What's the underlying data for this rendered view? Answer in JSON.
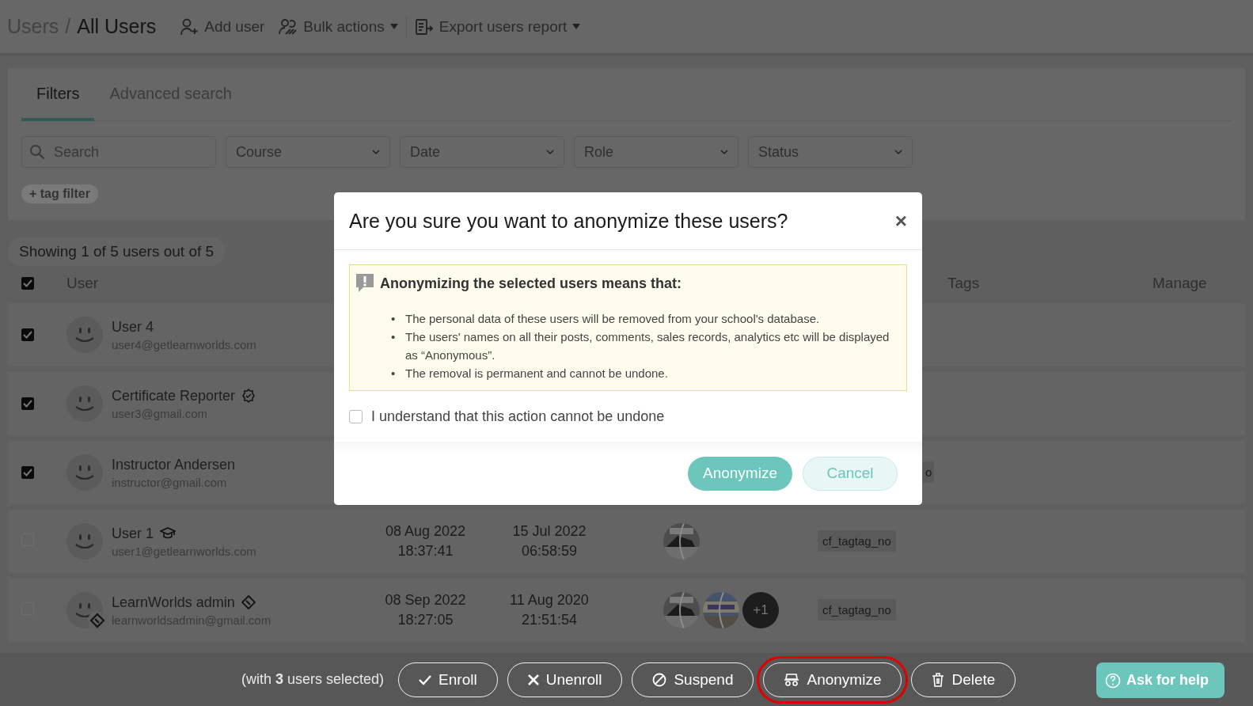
{
  "breadcrumb": [
    {
      "label": "Users",
      "current": false
    },
    {
      "label": "All Users",
      "current": true
    }
  ],
  "breadcrumb_separator": "/",
  "toolbar": [
    {
      "label": "Add user",
      "kind": "add",
      "dropdown": false
    },
    {
      "label": "Bulk actions",
      "kind": "bulk",
      "dropdown": true
    },
    {
      "label": "Export users report",
      "kind": "export",
      "dropdown": true
    }
  ],
  "tabs": [
    {
      "label": "Filters",
      "selected": true
    },
    {
      "label": "Advanced search",
      "selected": false
    }
  ],
  "filters": {
    "search": {
      "placeholder": "Search"
    },
    "dropdowns": [
      "Course",
      "Date",
      "Role",
      "Status"
    ],
    "tag_filter": "+ tag filter"
  },
  "summary": "Showing 1 of 5 users out of 5",
  "table": {
    "select_all": {
      "checked": true
    },
    "columns": [
      {
        "label": "User",
        "kind": "user"
      },
      {
        "label": "Tags",
        "kind": "tags"
      },
      {
        "label": "Manage",
        "kind": "manage"
      }
    ],
    "rows": [
      {
        "name": "User 4",
        "email": "user4@getlearnworlds.com",
        "checked": true,
        "avatar_badge": false
      },
      {
        "name": "Certificate Reporter",
        "email": "user3@gmail.com",
        "checked": true,
        "badges": [
          {
            "kind": "certificate"
          }
        ],
        "avatar_badge": false
      },
      {
        "name": "Instructor Andersen",
        "email": "instructor@gmail.com",
        "checked": true,
        "avatar_badge": false,
        "tags": [
          {
            "label": "o",
            "cut": true
          }
        ]
      },
      {
        "name": "User 1",
        "email": "user1@getlearnworlds.com",
        "checked": false,
        "badges": [
          {
            "kind": "graduation"
          }
        ],
        "avatar_badge": false,
        "date_1": [
          "08 Aug 2022",
          "18:37:41"
        ],
        "date_2": [
          "15 Jul 2022",
          "06:58:59"
        ],
        "courses": [
          {
            "kind": "picture"
          }
        ],
        "tags": [
          {
            "label": "cf_tagtag_no",
            "cut": false
          }
        ]
      },
      {
        "name": "LearnWorlds admin",
        "email": "learnworldsadmin@gmail.com",
        "checked": false,
        "badges": [
          {
            "kind": "diamond"
          }
        ],
        "avatar_badge": true,
        "date_1": [
          "08 Sep 2022",
          "18:27:05"
        ],
        "date_2": [
          "11 Aug 2020",
          "21:51:54"
        ],
        "courses": [
          {
            "kind": "picture"
          },
          {
            "kind": "picture"
          }
        ],
        "more_courses": "+1",
        "tags": [
          {
            "label": "cf_tagtag_no",
            "cut": false
          }
        ]
      }
    ]
  },
  "dialog": {
    "title": "Are you sure you want to anonymize these users?",
    "close": "×",
    "notice_title": "Anonymizing the selected users means that:",
    "bullet": "•",
    "notice_items": [
      "The personal data of these users will be removed from your school's database.",
      "The users' names on all their posts, comments, sales records, analytics etc will be displayed as “Anonymous”.",
      "The removal is permanent and cannot be undone."
    ],
    "confirm": {
      "label": "I understand that this action cannot be undone",
      "checked": false
    },
    "buttons": [
      {
        "label": "Anonymize",
        "kind": "primary"
      },
      {
        "label": "Cancel",
        "kind": "secondary"
      }
    ]
  },
  "bulk_bar": {
    "text": "(with **3** users selected)",
    "actions": [
      {
        "label": "Enroll",
        "kind": "check",
        "highlighted": false
      },
      {
        "label": "Unenroll",
        "kind": "cross",
        "highlighted": false
      },
      {
        "label": "Suspend",
        "kind": "ban",
        "highlighted": false
      },
      {
        "label": "Anonymize",
        "kind": "incognito",
        "highlighted": true
      },
      {
        "label": "Delete",
        "kind": "trash",
        "highlighted": false
      }
    ],
    "help": "Ask for help"
  }
}
